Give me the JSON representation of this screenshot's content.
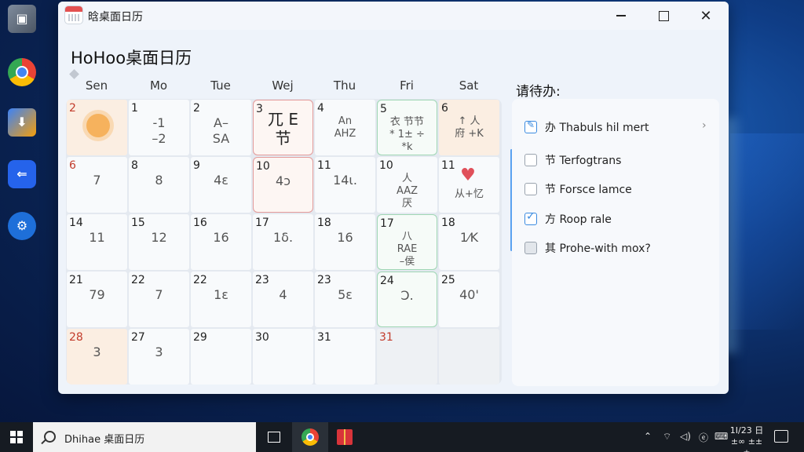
{
  "window": {
    "title": "晗桌面日历",
    "app_title": "HoHoo桌面日历"
  },
  "calendar": {
    "weekdays": [
      "Sen",
      "Mo",
      "Tue",
      "Wej",
      "Thu",
      "Fri",
      "Sat"
    ],
    "rows": [
      [
        {
          "day": "2",
          "red": true,
          "sub": "",
          "style": "warm",
          "icon": "sun-icon"
        },
        {
          "day": "1",
          "sub": "-1\n–2",
          "style": ""
        },
        {
          "day": "2",
          "sub": "A–\nSA",
          "style": ""
        },
        {
          "day": "3",
          "sub": "兀 E\n节",
          "style": "hl-red",
          "big": true
        },
        {
          "day": "4",
          "sub": "An\nAHZ",
          "style": "",
          "small": true
        },
        {
          "day": "5",
          "sub": "衣 节节\n* 1± ÷ *k",
          "style": "hl-green",
          "small": true
        },
        {
          "day": "6",
          "sub": "↑ 人\n 府 +K",
          "style": "warm",
          "small": true
        }
      ],
      [
        {
          "day": "6",
          "red": true,
          "sub": "7",
          "style": ""
        },
        {
          "day": "8",
          "sub": "8",
          "style": ""
        },
        {
          "day": "9",
          "sub": "4ε",
          "style": ""
        },
        {
          "day": "10",
          "sub": "4ɔ",
          "style": "hl-red"
        },
        {
          "day": "11",
          "sub": "14ι.",
          "style": ""
        },
        {
          "day": "10",
          "sub": "人\nAAZ\n厌",
          "style": "",
          "small": true
        },
        {
          "day": "11",
          "sub": "",
          "style": "",
          "icon": "heart-icon",
          "caption": "从+忆"
        }
      ],
      [
        {
          "day": "14",
          "sub": "11",
          "style": ""
        },
        {
          "day": "15",
          "sub": "12",
          "style": ""
        },
        {
          "day": "16",
          "sub": "16",
          "style": ""
        },
        {
          "day": "17",
          "sub": "1δ.",
          "style": ""
        },
        {
          "day": "18",
          "sub": "16",
          "style": ""
        },
        {
          "day": "17",
          "sub": "八\nRAE\n–侯",
          "style": "hl-green",
          "small": true
        },
        {
          "day": "18",
          "sub": "1⁄K",
          "style": ""
        }
      ],
      [
        {
          "day": "21",
          "sub": "79",
          "style": ""
        },
        {
          "day": "22",
          "sub": "7",
          "style": ""
        },
        {
          "day": "22",
          "sub": "1ε",
          "style": ""
        },
        {
          "day": "23",
          "sub": "4",
          "style": ""
        },
        {
          "day": "23",
          "sub": "5ε",
          "style": ""
        },
        {
          "day": "24",
          "sub": "Ͻ.",
          "style": "hl-green"
        },
        {
          "day": "25",
          "sub": "40'",
          "style": ""
        }
      ],
      [
        {
          "day": "28",
          "red": true,
          "sub": "3",
          "style": "warm"
        },
        {
          "day": "27",
          "sub": "3",
          "style": ""
        },
        {
          "day": "29",
          "sub": "",
          "style": ""
        },
        {
          "day": "30",
          "sub": "",
          "style": ""
        },
        {
          "day": "31",
          "sub": "",
          "style": ""
        },
        {
          "day": "31",
          "red": true,
          "sub": "",
          "style": "grey"
        },
        {
          "day": "",
          "sub": "",
          "style": "blank"
        }
      ]
    ]
  },
  "todo": {
    "title": "请待办:",
    "items": [
      {
        "label": "办 Thabuls hil mert",
        "state": "edit",
        "chevron": "›"
      },
      {
        "label": "节 Terfogtrans",
        "state": "off"
      },
      {
        "label": "节 Forsce lamce",
        "state": "off"
      },
      {
        "label": "方 Roop rale",
        "state": "on"
      },
      {
        "label": "其 Prohe-with mox?",
        "state": "grey"
      }
    ]
  },
  "taskbar": {
    "search_text": "Dhihae 桌面日历",
    "clock_time": "1I/23 日",
    "clock_date": "±∞ ±±±"
  }
}
